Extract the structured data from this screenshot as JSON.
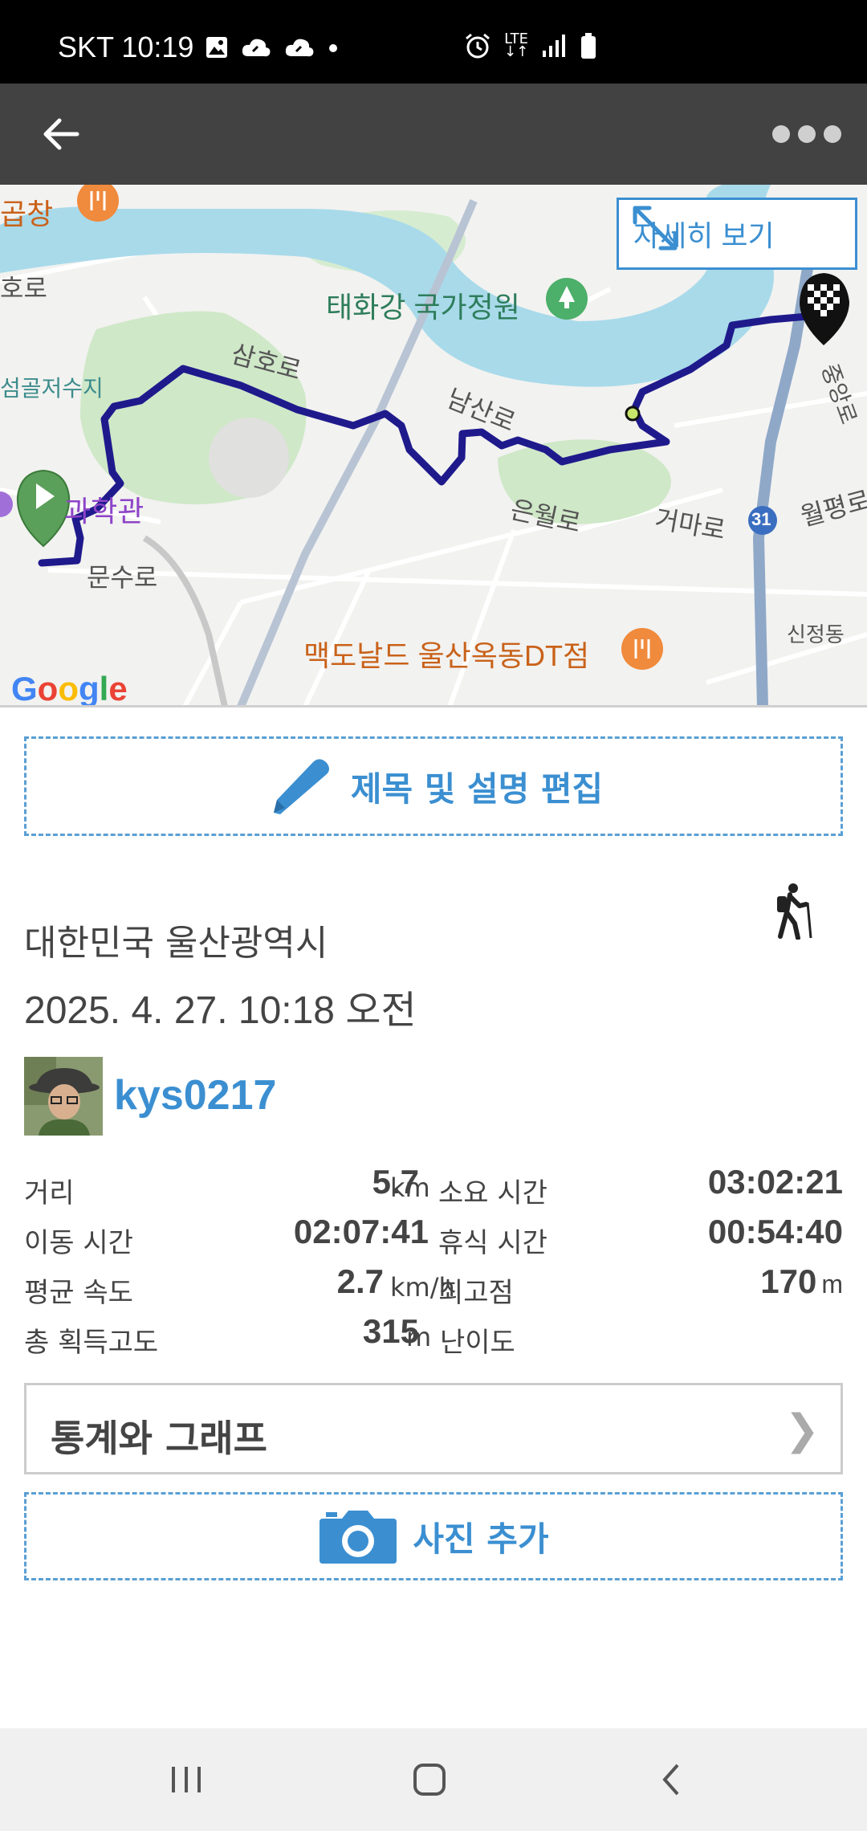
{
  "status_bar": {
    "carrier_time": "SKT 10:19",
    "network": "LTE",
    "icons_left": [
      "gallery-icon",
      "cloud-icon",
      "cloud-icon",
      "dot-icon"
    ],
    "icons_right": [
      "alarm-icon",
      "lte-icon",
      "signal-icon",
      "battery-icon"
    ]
  },
  "app_bar": {
    "back_icon": "arrow-left-icon",
    "more_icon": "more-horizontal-icon"
  },
  "map": {
    "detail_button_label": "자세히 보기",
    "google_logo": "Google",
    "labels": {
      "restaurant_top": "곱창",
      "road_left": "호로",
      "park": "태화강 국가정원",
      "samho_ro": "삼호로",
      "reservoir": "섬골저수지",
      "namsan_ro": "남산로",
      "museum": "과학관",
      "eunwol_ro": "은월로",
      "geoma_ro": "거마로",
      "wolpyeong_ro": "월평로",
      "jungang_ro": "중앙로",
      "route_31": "31",
      "munsu_ro": "문수로",
      "sinjeong_dong": "신정동",
      "mcdonalds": "맥도날드 울산옥동DT점"
    },
    "colors": {
      "route": "#1f1a8c",
      "river": "#a8daea",
      "park": "#cfe8c8",
      "road_major": "#8fa8c8"
    }
  },
  "edit_button": {
    "label": "제목 및 설명 편집",
    "icon": "pencil-icon"
  },
  "activity": {
    "location": "대한민국 울산광역시",
    "datetime": "2025. 4. 27. 10:18 오전",
    "type_icon": "hiker-icon",
    "username": "kys0217"
  },
  "stats": {
    "rows": [
      {
        "label1": "거리",
        "value1": "5.7",
        "unit1": "km",
        "label2": "소요 시간",
        "value2": "03:02:21",
        "unit2": ""
      },
      {
        "label1": "이동 시간",
        "value1": "02:07:41",
        "unit1": "",
        "label2": "휴식 시간",
        "value2": "00:54:40",
        "unit2": ""
      },
      {
        "label1": "평균 속도",
        "value1": "2.7",
        "unit1": "km/h",
        "label2": "최고점",
        "value2": "170",
        "unit2": "m"
      },
      {
        "label1": "총 획득고도",
        "value1": "315",
        "unit1": "m",
        "label2": "난이도",
        "value2": "",
        "unit2": ""
      }
    ]
  },
  "graph_button": {
    "label": "통계와 그래프",
    "chevron": "❯"
  },
  "photo_button": {
    "label": "사진 추가",
    "icon": "camera-icon"
  },
  "nav_bar": {
    "items": [
      "recent-apps-icon",
      "home-icon",
      "back-icon"
    ]
  },
  "accent_color": "#3b8fd1"
}
